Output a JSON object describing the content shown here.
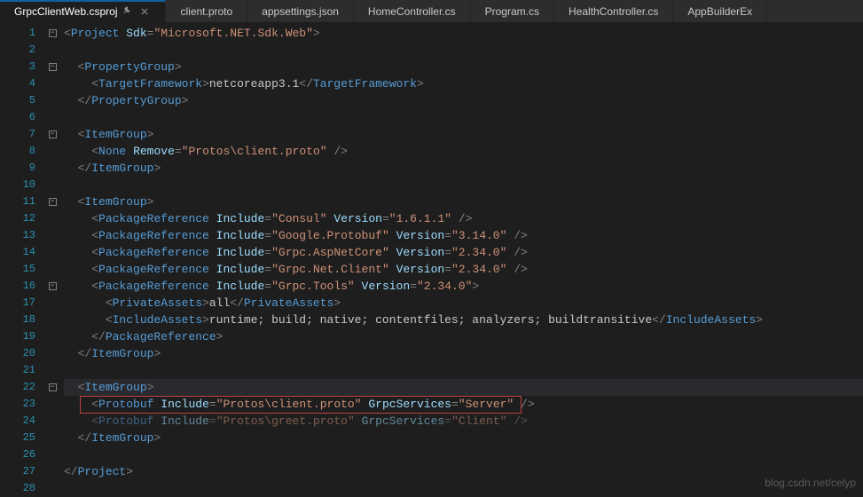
{
  "tabs": [
    {
      "label": "GrpcClientWeb.csproj",
      "active": true
    },
    {
      "label": "client.proto"
    },
    {
      "label": "appsettings.json"
    },
    {
      "label": "HomeController.cs"
    },
    {
      "label": "Program.cs"
    },
    {
      "label": "HealthController.cs"
    },
    {
      "label": "AppBuilderEx"
    }
  ],
  "line_numbers": [
    "1",
    "2",
    "3",
    "4",
    "5",
    "6",
    "7",
    "8",
    "9",
    "10",
    "11",
    "12",
    "13",
    "14",
    "15",
    "16",
    "17",
    "18",
    "19",
    "20",
    "21",
    "22",
    "23",
    "24",
    "25",
    "26",
    "27",
    "28"
  ],
  "code": {
    "project_sdk": "Microsoft.NET.Sdk.Web",
    "target_framework": "netcoreapp3.1",
    "none_remove": "Protos\\client.proto",
    "pkg_consul": {
      "inc": "Consul",
      "ver": "1.6.1.1"
    },
    "pkg_protobuf": {
      "inc": "Google.Protobuf",
      "ver": "3.14.0"
    },
    "pkg_aspnet": {
      "inc": "Grpc.AspNetCore",
      "ver": "2.34.0"
    },
    "pkg_netclient": {
      "inc": "Grpc.Net.Client",
      "ver": "2.34.0"
    },
    "pkg_tools": {
      "inc": "Grpc.Tools",
      "ver": "2.34.0"
    },
    "private_assets": "all",
    "include_assets": "runtime; build; native; contentfiles; analyzers; buildtransitive",
    "proto1": {
      "inc": "Protos\\client.proto",
      "svc": "Server"
    },
    "proto2": {
      "inc": "Protos\\greet.proto",
      "svc": "Client"
    }
  },
  "watermark": "blog.csdn.net/celyp"
}
